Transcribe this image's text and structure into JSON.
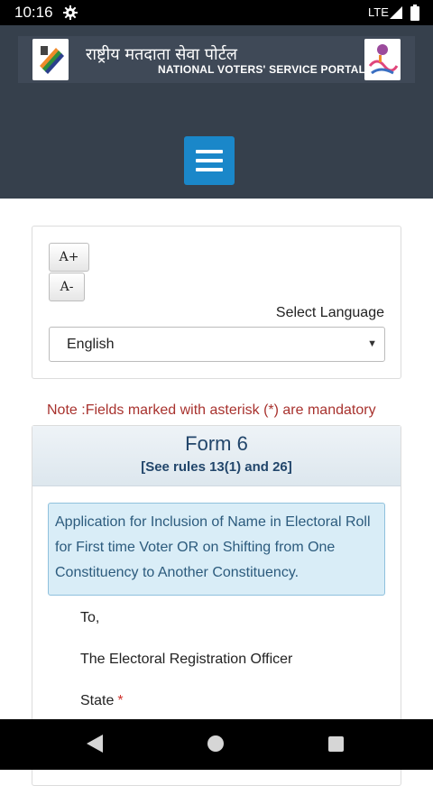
{
  "status_bar": {
    "time": "10:16",
    "network": "LTE",
    "icons": [
      "gear-icon",
      "signal-icon",
      "battery-icon"
    ]
  },
  "header": {
    "title_hindi": "राष्ट्रीय मतदाता सेवा पोर्टल",
    "title_english": "NATIONAL VOTERS' SERVICE PORTAL",
    "menu_icon": "hamburger-menu-icon",
    "colors": {
      "background": "#36404c",
      "menu_button": "#1a87c9"
    }
  },
  "language_panel": {
    "increase_font_label": "A+",
    "decrease_font_label": "A-",
    "select_language_label": "Select Language",
    "selected_language": "English"
  },
  "note": "Note :Fields marked with asterisk (*) are mandatory",
  "form": {
    "title": "Form 6",
    "rules": "[See rules 13(1) and 26]",
    "description": "Application for Inclusion of Name in Electoral Roll for First time Voter OR on Shifting from One Constituency to Another Constituency.",
    "to_label": "To,",
    "officer_label": "The Electoral Registration Officer",
    "state_label": "State",
    "required_marker": "*"
  },
  "nav_bar": {
    "icons": [
      "back-icon",
      "home-icon",
      "recents-icon"
    ]
  }
}
